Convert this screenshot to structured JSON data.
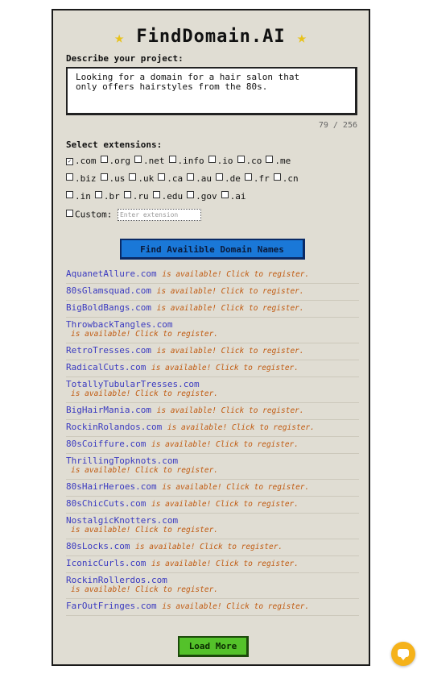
{
  "app": {
    "title": "FindDomain.AI",
    "star_glyph": "★"
  },
  "project": {
    "label": "Describe your project:",
    "description": "Looking for a domain for a hair salon that\nonly offers hairstyles from the 80s.",
    "char_count": "79 / 256"
  },
  "extensions": {
    "label": "Select extensions:",
    "rows": [
      [
        {
          "ext": ".com",
          "checked": true
        },
        {
          "ext": ".org",
          "checked": false
        },
        {
          "ext": ".net",
          "checked": false
        },
        {
          "ext": ".info",
          "checked": false
        },
        {
          "ext": ".io",
          "checked": false
        },
        {
          "ext": ".co",
          "checked": false
        },
        {
          "ext": ".me",
          "checked": false
        }
      ],
      [
        {
          "ext": ".biz",
          "checked": false
        },
        {
          "ext": ".us",
          "checked": false
        },
        {
          "ext": ".uk",
          "checked": false
        },
        {
          "ext": ".ca",
          "checked": false
        },
        {
          "ext": ".au",
          "checked": false
        },
        {
          "ext": ".de",
          "checked": false
        },
        {
          "ext": ".fr",
          "checked": false
        },
        {
          "ext": ".cn",
          "checked": false
        }
      ],
      [
        {
          "ext": ".in",
          "checked": false
        },
        {
          "ext": ".br",
          "checked": false
        },
        {
          "ext": ".ru",
          "checked": false
        },
        {
          "ext": ".edu",
          "checked": false
        },
        {
          "ext": ".gov",
          "checked": false
        },
        {
          "ext": ".ai",
          "checked": false
        }
      ]
    ],
    "custom_label": "Custom:",
    "custom_placeholder": "Enter extension"
  },
  "find_button": "Find Availible Domain Names",
  "availability_text": "is available! Click to register.",
  "results": [
    {
      "domain": "AquanetAllure.com",
      "wrap": false
    },
    {
      "domain": "80sGlamsquad.com",
      "wrap": false
    },
    {
      "domain": "BigBoldBangs.com",
      "wrap": false
    },
    {
      "domain": "ThrowbackTangles.com",
      "wrap": true
    },
    {
      "domain": "RetroTresses.com",
      "wrap": false
    },
    {
      "domain": "RadicalCuts.com",
      "wrap": false
    },
    {
      "domain": "TotallyTubularTresses.com",
      "wrap": true
    },
    {
      "domain": "BigHairMania.com",
      "wrap": false
    },
    {
      "domain": "RockinRolandos.com",
      "wrap": false
    },
    {
      "domain": "80sCoiffure.com",
      "wrap": false
    },
    {
      "domain": "ThrillingTopknots.com",
      "wrap": true
    },
    {
      "domain": "80sHairHeroes.com",
      "wrap": false
    },
    {
      "domain": "80sChicCuts.com",
      "wrap": false
    },
    {
      "domain": "NostalgicKnotters.com",
      "wrap": true
    },
    {
      "domain": "80sLocks.com",
      "wrap": false
    },
    {
      "domain": "IconicCurls.com",
      "wrap": false
    },
    {
      "domain": "RockinRollerdos.com",
      "wrap": true
    },
    {
      "domain": "FarOutFringes.com",
      "wrap": false
    }
  ],
  "load_more_button": "Load More",
  "colors": {
    "panel_bg": "#e0ddd3",
    "find_button": "#1a78d8",
    "load_more_button": "#54c22a",
    "domain_link": "#3a3ac0",
    "availability": "#c05a10",
    "star": "#e8c21a",
    "chat_bubble": "#f5b21a"
  },
  "icons": {
    "title_stars": "star-icon",
    "chat": "chat-bubble-icon",
    "checkbox_checked": "check-icon"
  }
}
